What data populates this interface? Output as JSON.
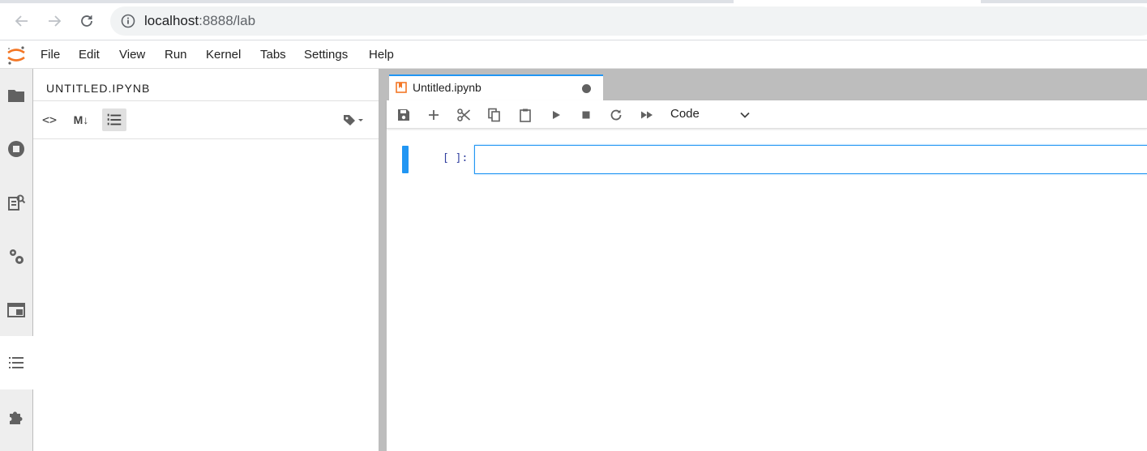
{
  "browser": {
    "url_host": "localhost",
    "url_path": ":8888/lab"
  },
  "menubar": {
    "items": [
      "File",
      "Edit",
      "View",
      "Run",
      "Kernel",
      "Tabs",
      "Settings",
      "Help"
    ]
  },
  "activity_bar": {
    "icons": [
      "folder-icon",
      "running-icon",
      "property-inspector-icon",
      "settings-gear-icon",
      "tabs-icon",
      "toc-list-icon",
      "extension-puzzle-icon"
    ],
    "active": "toc-list-icon"
  },
  "left_panel": {
    "title": "UNTITLED.IPYNB",
    "toolbar": {
      "code_label": "<>",
      "markdown_label": "M↓"
    }
  },
  "document": {
    "tab_label": "Untitled.ipynb",
    "cell_type": "Code",
    "cell_prompt": "[ ]:"
  },
  "colors": {
    "accent": "#2196f3",
    "jupyter_orange": "#f37726",
    "prompt": "#303f9f"
  }
}
